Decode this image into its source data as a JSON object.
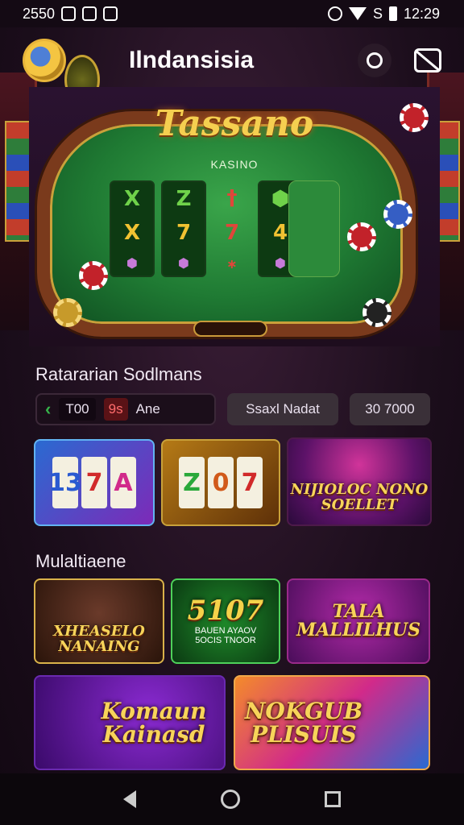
{
  "status_bar": {
    "time_left": "2550",
    "time_right": "12:29",
    "signal_text": "S",
    "icons": [
      "notification-icon",
      "notification-icon",
      "shield-icon",
      "alarm-icon",
      "wifi-icon",
      "battery-icon"
    ]
  },
  "header": {
    "title": "Ilndansisia",
    "icons": [
      "profile-icon",
      "cast-icon"
    ]
  },
  "hero": {
    "title": "Tassano",
    "subtitle": "KASINO",
    "reels": [
      [
        "X",
        "X",
        "⬢"
      ],
      [
        "Z",
        "7",
        "⬢"
      ],
      [
        "†",
        "7",
        "∗"
      ],
      [
        "⬢",
        "4",
        "⬢"
      ]
    ]
  },
  "section1": {
    "title": "Ratararian Sodlmans",
    "filter": {
      "value": "T00",
      "badge": "9s",
      "extra": "Ane"
    },
    "button_mid": "Ssaxl Nadat",
    "button_right": "30 7000",
    "tiles": [
      {
        "reels": [
          "13",
          "7",
          "A"
        ],
        "label": ""
      },
      {
        "reels": [
          "Z",
          "0",
          "7"
        ],
        "label": ""
      },
      {
        "label": "NIJIOLOC NONO SOELLET"
      }
    ]
  },
  "section2": {
    "title": "Mulaltiaene",
    "tiles": [
      {
        "label": "XHEASELO NANAING"
      },
      {
        "label": "5107",
        "sublabel": "BAUEN AYAOV 5OCIS TNOOR"
      },
      {
        "label": "TALA MALLILHUS"
      }
    ]
  },
  "section3": {
    "tiles": [
      {
        "label": "Komaun Kainasd"
      },
      {
        "label": "NOKGUB PLISUIS"
      }
    ]
  },
  "nav": {
    "icons": [
      "back-icon",
      "home-icon",
      "recents-icon"
    ]
  }
}
